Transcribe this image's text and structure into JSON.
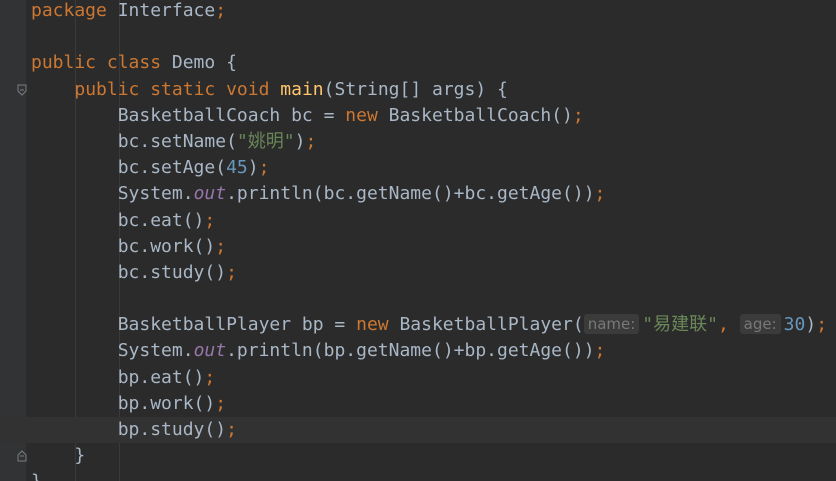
{
  "editor": {
    "lines": [
      {
        "t": [
          {
            "c": "kw",
            "v": "package"
          },
          {
            "c": "",
            "v": " Interface"
          },
          {
            "c": "kw",
            "v": ";"
          }
        ]
      },
      {
        "t": []
      },
      {
        "t": [
          {
            "c": "kw",
            "v": "public class"
          },
          {
            "c": "",
            "v": " Demo {"
          }
        ]
      },
      {
        "t": [
          {
            "c": "",
            "v": "    "
          },
          {
            "c": "kw",
            "v": "public static void"
          },
          {
            "c": "",
            "v": " "
          },
          {
            "c": "fn",
            "v": "main"
          },
          {
            "c": "",
            "v": "(String[] args) {"
          }
        ]
      },
      {
        "t": [
          {
            "c": "",
            "v": "        BasketballCoach bc = "
          },
          {
            "c": "kw",
            "v": "new"
          },
          {
            "c": "",
            "v": " BasketballCoach()"
          },
          {
            "c": "kw",
            "v": ";"
          }
        ]
      },
      {
        "t": [
          {
            "c": "",
            "v": "        bc.setName("
          },
          {
            "c": "str",
            "v": "\"姚明\""
          },
          {
            "c": "",
            "v": ")"
          },
          {
            "c": "kw",
            "v": ";"
          }
        ]
      },
      {
        "t": [
          {
            "c": "",
            "v": "        bc.setAge("
          },
          {
            "c": "num",
            "v": "45"
          },
          {
            "c": "",
            "v": ")"
          },
          {
            "c": "kw",
            "v": ";"
          }
        ]
      },
      {
        "t": [
          {
            "c": "",
            "v": "        System."
          },
          {
            "c": "stat",
            "v": "out"
          },
          {
            "c": "",
            "v": ".println(bc.getName()+bc.getAge())"
          },
          {
            "c": "kw",
            "v": ";"
          }
        ]
      },
      {
        "t": [
          {
            "c": "",
            "v": "        bc.eat()"
          },
          {
            "c": "kw",
            "v": ";"
          }
        ]
      },
      {
        "t": [
          {
            "c": "",
            "v": "        bc.work()"
          },
          {
            "c": "kw",
            "v": ";"
          }
        ]
      },
      {
        "t": [
          {
            "c": "",
            "v": "        bc.study()"
          },
          {
            "c": "kw",
            "v": ";"
          }
        ]
      },
      {
        "t": []
      },
      {
        "t": [
          {
            "c": "",
            "v": "        BasketballPlayer bp = "
          },
          {
            "c": "kw",
            "v": "new"
          },
          {
            "c": "",
            "v": " BasketballPlayer("
          },
          {
            "c": "hint",
            "v": "name:"
          },
          {
            "c": "str",
            "v": "\"易建联\""
          },
          {
            "c": "kw",
            "v": ", "
          },
          {
            "c": "hint",
            "v": "age:"
          },
          {
            "c": "num",
            "v": "30"
          },
          {
            "c": "",
            "v": ")"
          },
          {
            "c": "kw",
            "v": ";"
          }
        ]
      },
      {
        "t": [
          {
            "c": "",
            "v": "        System."
          },
          {
            "c": "stat",
            "v": "out"
          },
          {
            "c": "",
            "v": ".println(bp.getName()+bp.getAge())"
          },
          {
            "c": "kw",
            "v": ";"
          }
        ]
      },
      {
        "t": [
          {
            "c": "",
            "v": "        bp.eat()"
          },
          {
            "c": "kw",
            "v": ";"
          }
        ]
      },
      {
        "t": [
          {
            "c": "",
            "v": "        bp.work()"
          },
          {
            "c": "kw",
            "v": ";"
          }
        ]
      },
      {
        "t": [
          {
            "c": "",
            "v": "        bp.study()"
          },
          {
            "c": "kw",
            "v": ";"
          }
        ],
        "current": true
      },
      {
        "t": [
          {
            "c": "",
            "v": "    }"
          }
        ]
      },
      {
        "t": [
          {
            "c": "",
            "v": "}"
          }
        ]
      }
    ],
    "colors": {
      "background": "#2b2b2b",
      "gutter": "#313335",
      "keyword": "#cc7832",
      "method": "#ffc66d",
      "string": "#6a8759",
      "number": "#6897bb",
      "static_field": "#9876aa",
      "text": "#a9b7c6"
    },
    "fold_markers": [
      {
        "line": 3,
        "icon": "fold-open-icon"
      },
      {
        "line": 17,
        "icon": "fold-close-icon"
      }
    ]
  }
}
